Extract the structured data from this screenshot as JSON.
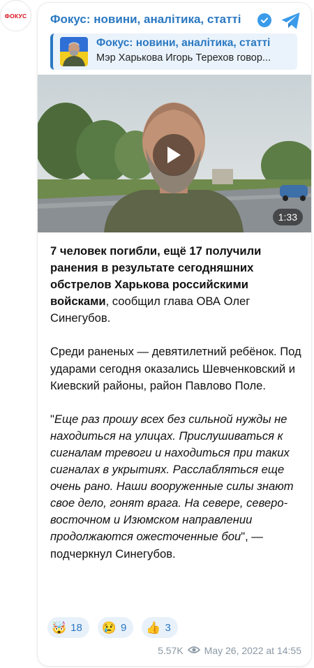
{
  "left_avatar": {
    "label": "ФОКУС"
  },
  "header": {
    "channel_name": "Фокус: новини, аналітика, статті",
    "verified_icon": "verified-checkmark-icon",
    "app_icon": "telegram-icon"
  },
  "reply": {
    "title": "Фокус: новини, аналітика, статті",
    "text": "Мэр Харькова Игорь Терехов говор..."
  },
  "video": {
    "duration": "1:33",
    "play_icon": "play-icon"
  },
  "message": {
    "p1_bold": "7 человек погибли, ещё 17 получили ранения в результате сегодняшних обстрелов Харькова российскими войсками",
    "p1_rest": ", сообщил глава ОВА Олег Синегубов.",
    "p2": "Среди раненых — девятилетний ребёнок. Под ударами сегодня оказались Шевченковский и Киевский районы, район Павлово Поле.",
    "p3_open": "\"",
    "p3_italic": "Еще раз прошу всех без сильной нужды не находиться на улицах. Прислушиваться к сигналам тревоги и находиться при таких сигналах в укрытиях. Расслабляться еще очень рано. Наши вооруженные силы знают свое дело, гонят врага. На севере, северо-восточном и Изюмском направлении продолжаются ожесточенные бои",
    "p3_rest": "\", — подчеркнул Синегубов."
  },
  "reactions": [
    {
      "emoji": "🤯",
      "count": "18"
    },
    {
      "emoji": "😢",
      "count": "9"
    },
    {
      "emoji": "👍",
      "count": "3"
    }
  ],
  "footer": {
    "views": "5.57K",
    "views_icon": "eye-icon",
    "date": "May 26, 2022 at 14:55"
  },
  "colors": {
    "accent": "#2a78c2",
    "reply_bg": "#eaf3fb",
    "reaction_bg": "#e8f1fa",
    "meta": "#8a98a4",
    "brand_red": "#d6121f"
  }
}
